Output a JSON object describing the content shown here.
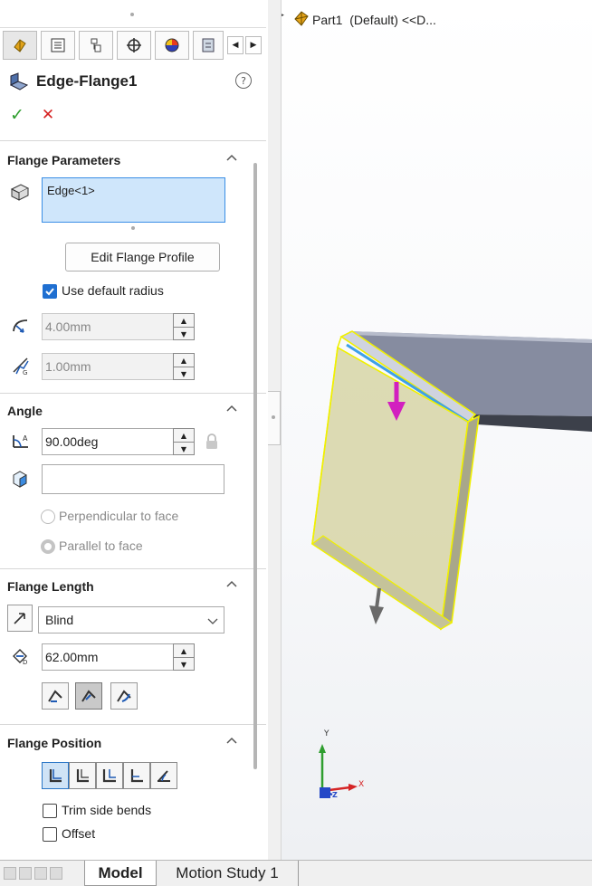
{
  "panel": {
    "feature_title": "Edge-Flange1",
    "help_icon": "?",
    "ok_icon": "✓",
    "cancel_icon": "✕",
    "tabs": [
      "feature-manager-icon",
      "property-manager-icon",
      "configuration-manager-icon",
      "dim-xpert-icon",
      "display-manager-icon",
      "more-icon"
    ]
  },
  "flange_parameters": {
    "title": "Flange Parameters",
    "edge_selection": "Edge<1>",
    "edit_profile_label": "Edit Flange Profile",
    "use_default_radius_label": "Use default radius",
    "use_default_radius_checked": true,
    "bend_radius": "4.00mm",
    "gap_distance": "1.00mm"
  },
  "angle": {
    "title": "Angle",
    "value": "90.00deg",
    "reference_face": "",
    "perpendicular_label": "Perpendicular to face",
    "parallel_label": "Parallel to face",
    "selected_option": "parallel"
  },
  "flange_length": {
    "title": "Flange Length",
    "end_condition": "Blind",
    "value": "62.00mm",
    "selected_mode": 1
  },
  "flange_position": {
    "title": "Flange Position",
    "selected_position": 0,
    "trim_side_bends_label": "Trim side bends",
    "trim_side_bends_checked": false,
    "offset_label": "Offset",
    "offset_checked": false
  },
  "bottom_tabs": [
    {
      "label": "Model",
      "active": true
    },
    {
      "label": "Motion Study 1",
      "active": false
    }
  ],
  "viewport": {
    "tree_item": "Part1  (Default) <<D...",
    "axis_x": "X",
    "axis_y": "Y",
    "axis_z": "Z"
  },
  "colors": {
    "accent": "#1f6fd1",
    "ok": "#2e9e2e",
    "cancel": "#d62020",
    "selection_yellow": "#f0f000",
    "preview_arrow": "#d21fbf"
  }
}
